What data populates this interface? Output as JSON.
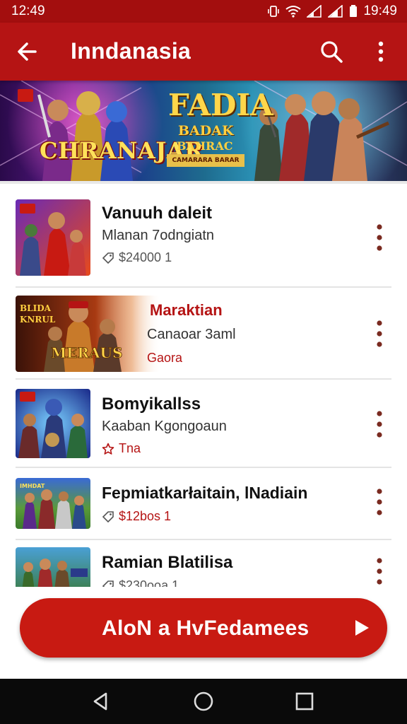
{
  "status_bar": {
    "time_left": "12:49",
    "time_right": "19:49"
  },
  "app_bar": {
    "title": "Inndanasia"
  },
  "banner": {
    "left_title": "CHRANAJAR",
    "mid_title": "FADIA",
    "mid_sub1": "BADAK",
    "mid_sub2": "BAHRAC",
    "mid_tag": "CAMARARA BARAR"
  },
  "list_items": [
    {
      "name": "Vanuuh daleit",
      "subtitle": "Mlanan 7odngiatn",
      "meta": "$24000 1",
      "meta_icon": "tag-icon"
    },
    {
      "name": "Maraktian",
      "subtitle": "Canaoar 3aml",
      "meta": "Gaora",
      "meta_icon": "none",
      "thumb_text": "MERAUS"
    },
    {
      "name": "Bomyikallss",
      "subtitle": "Kaaban Kgongoaun",
      "meta": "Tna",
      "meta_icon": "star-icon"
    },
    {
      "name": "Fepmiatkarłaitain, lNadiain",
      "subtitle": "",
      "meta": "$12bos 1",
      "meta_icon": "tag-icon"
    },
    {
      "name": "Ramian Blatilisa",
      "subtitle": "",
      "meta": "$230ooa 1",
      "meta_icon": "tag-icon"
    }
  ],
  "cta": {
    "label": "AloN a HvFedamees"
  },
  "colors": {
    "primary": "#b51414",
    "status": "#a30e0e",
    "cta": "#c81a12",
    "nav": "#0a0a0a"
  }
}
